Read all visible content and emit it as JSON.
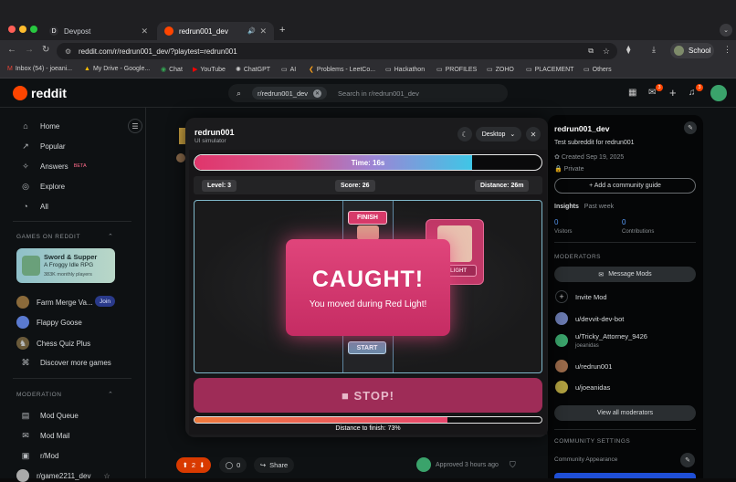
{
  "browser": {
    "tabs": [
      {
        "label": "Devpost",
        "favicon": "D"
      },
      {
        "label": "redrun001_dev"
      }
    ],
    "new_tab": "+",
    "url": "reddit.com/r/redrun001_dev/?playtest=redrun001",
    "profile": "School",
    "bookmarks": [
      "Inbox (54) - joeani...",
      "My Drive - Google...",
      "Chat",
      "YouTube",
      "ChatGPT",
      "AI",
      "Problems - LeetCo...",
      "Hackathon",
      "PROFILES",
      "ZOHO",
      "PLACEMENT",
      "Others"
    ]
  },
  "reddit": {
    "logo": "reddit",
    "search": {
      "chip": "r/redrun001_dev",
      "placeholder": "Search in r/redrun001_dev"
    },
    "badges": {
      "chat": "3",
      "notifications": "3"
    }
  },
  "sidebar": {
    "nav": [
      {
        "label": "Home",
        "icon": "home-icon"
      },
      {
        "label": "Popular",
        "icon": "popular-icon"
      },
      {
        "label": "Answers",
        "icon": "answers-icon",
        "badge": "BETA"
      },
      {
        "label": "Explore",
        "icon": "explore-icon"
      },
      {
        "label": "All",
        "icon": "all-icon"
      }
    ],
    "games_header": "GAMES ON REDDIT",
    "featured_game": {
      "title": "Sword & Supper",
      "subtitle": "A Froggy Idle RPG",
      "players": "383K monthly players"
    },
    "games": [
      {
        "label": "Farm Merge Va...",
        "action": "Join"
      },
      {
        "label": "Flappy Goose"
      },
      {
        "label": "Chess Quiz Plus"
      },
      {
        "label": "Discover more games"
      }
    ],
    "moderation_header": "MODERATION",
    "moderation": [
      {
        "label": "Mod Queue"
      },
      {
        "label": "Mod Mail"
      },
      {
        "label": "r/Mod"
      },
      {
        "label": "r/game2211_dev"
      }
    ]
  },
  "modal": {
    "title": "redrun001",
    "subtitle": "UI simulator",
    "device": "Desktop",
    "game": {
      "timer_label": "Time: 16s",
      "timer_fraction": 0.8,
      "level": "Level: 3",
      "score": "Score: 26",
      "distance": "Distance: 26m",
      "finish_label": "FINISH",
      "start_label": "START",
      "light_label": "LIGHT",
      "caught_title": "CAUGHT!",
      "caught_message": "You moved during Red Light!",
      "stop_button": "■ STOP!",
      "progress_fraction": 0.73,
      "progress_label": "Distance to finish: 73%"
    }
  },
  "right_panel": {
    "name": "redrun001_dev",
    "description": "Test subreddit for redrun001",
    "created": "Created Sep 19, 2025",
    "privacy": "Private",
    "add_guide": "+ Add a community guide",
    "insights": "Insights",
    "insights_period": "Past week",
    "visitors_value": "0",
    "visitors_label": "Visitors",
    "contributions_value": "0",
    "contributions_label": "Contributions",
    "moderators_header": "MODERATORS",
    "message_mods": "Message Mods",
    "invite_mod": "Invite Mod",
    "mods": [
      {
        "name": "u/devvit-dev-bot",
        "sub": ""
      },
      {
        "name": "u/Tricky_Attorney_9426",
        "sub": "joeanidas"
      },
      {
        "name": "u/redrun001",
        "sub": ""
      },
      {
        "name": "u/joeanidas",
        "sub": ""
      }
    ],
    "view_all": "View all moderators",
    "settings_header": "COMMUNITY SETTINGS",
    "community_appearance": "Community Appearance"
  },
  "post_footer": {
    "votes": "2",
    "comments": "0",
    "share": "Share",
    "approved": "Approved 3 hours ago"
  },
  "colors": {
    "accent": "#e0457b",
    "reddit_orange": "#ff4500",
    "timer_end": "#3fc6e6"
  }
}
